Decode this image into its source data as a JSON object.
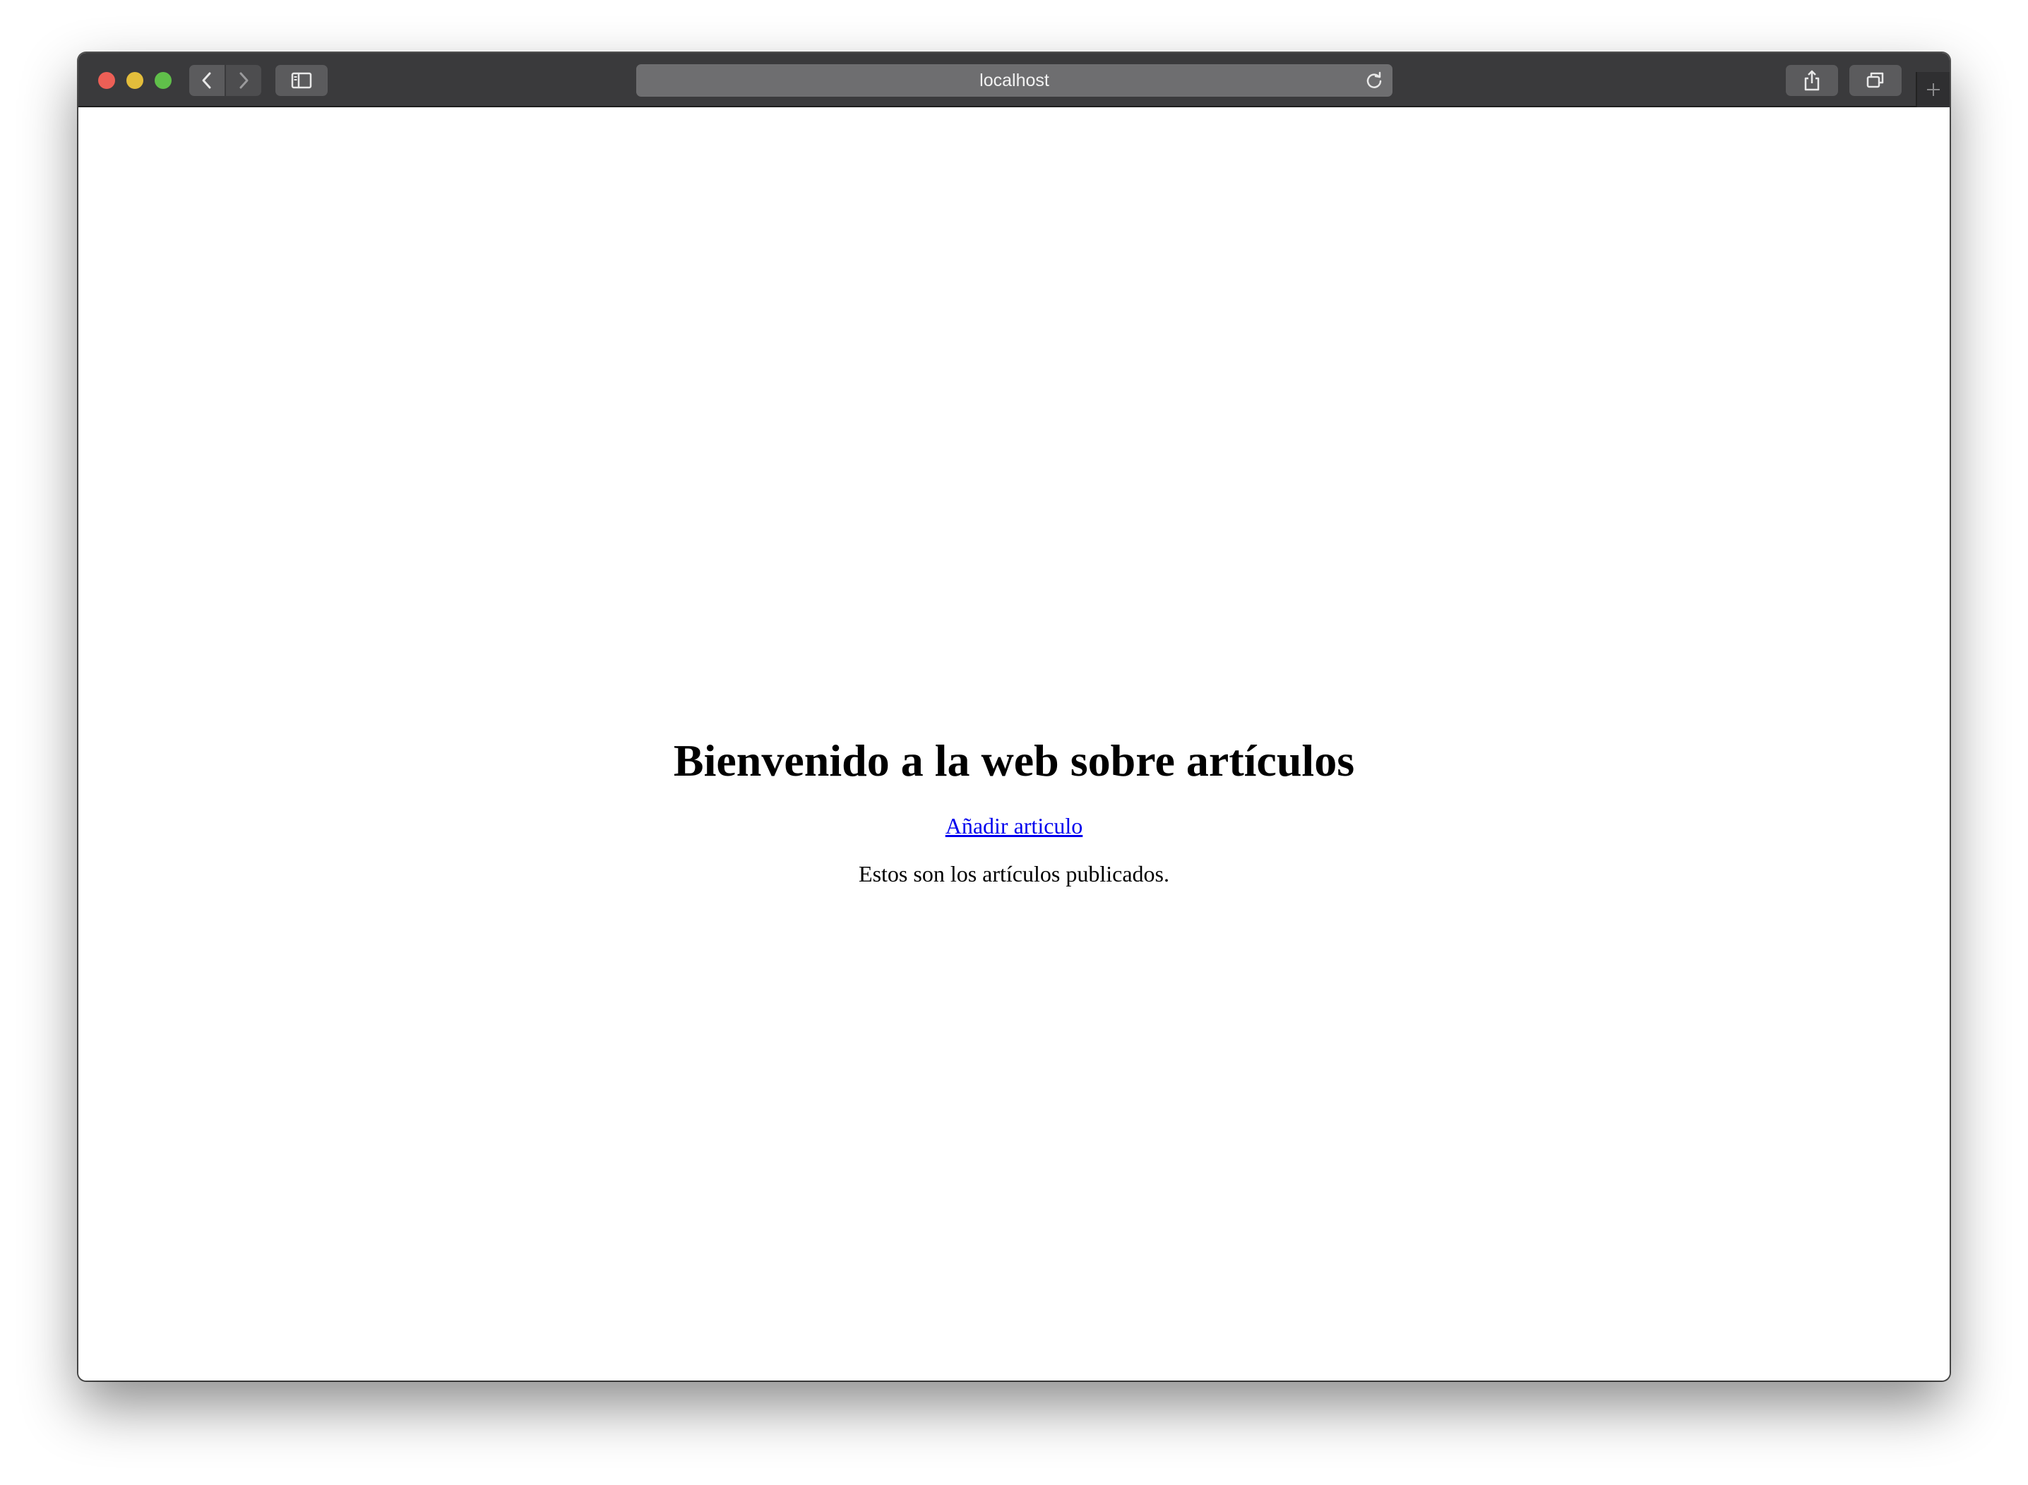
{
  "browser": {
    "address": "localhost",
    "icons": {
      "back": "chevron-left-icon",
      "forward": "chevron-right-icon",
      "sidebar": "sidebar-icon",
      "reload": "reload-icon",
      "share": "share-icon",
      "tabs": "tabs-overview-icon",
      "new_tab": "plus-icon"
    },
    "colors": {
      "close": "#ed5f56",
      "minimize": "#e3bd3b",
      "maximize": "#60bf4a",
      "toolbar": "#3a3a3c"
    }
  },
  "page": {
    "heading": "Bienvenido a la web sobre artículos",
    "add_link": "Añadir articulo",
    "intro": "Estos son los artículos publicados.",
    "link_color": "#0000ee"
  }
}
